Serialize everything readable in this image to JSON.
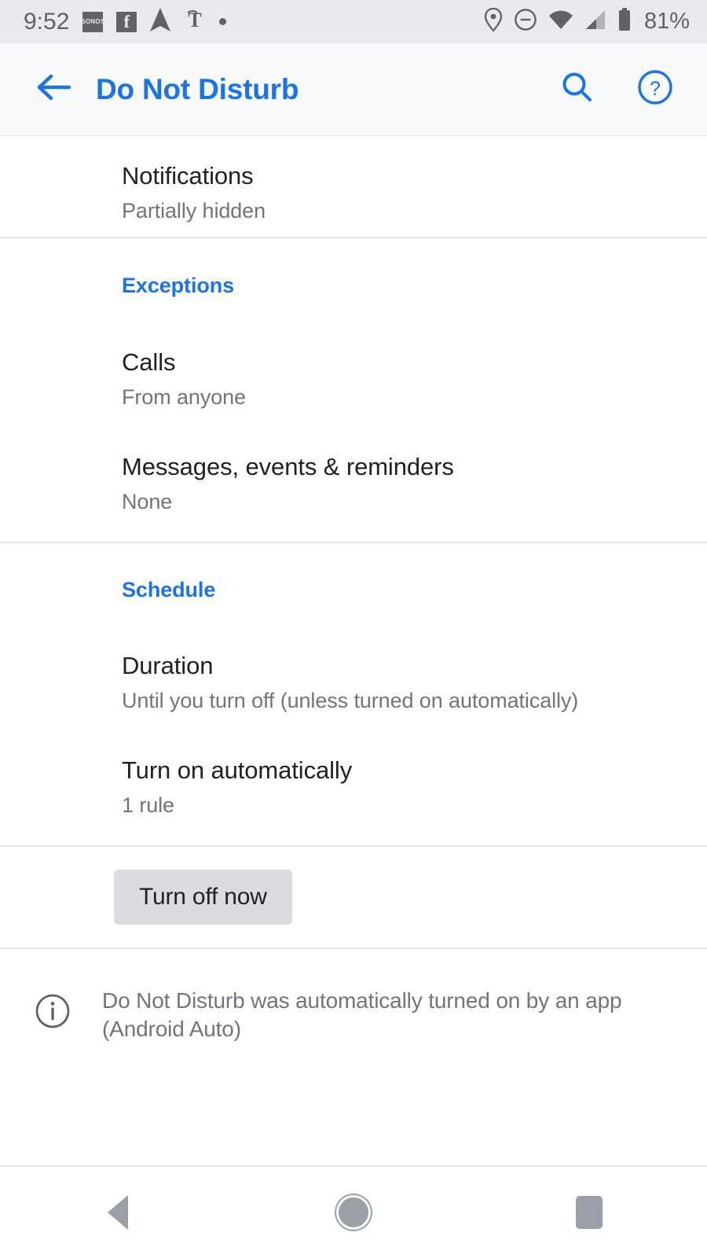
{
  "status_bar": {
    "time": "9:52",
    "battery_percent": "81%",
    "left_icons": [
      "sonos-icon",
      "facebook-icon",
      "navigation-arrow-icon",
      "nytimes-icon",
      "dot-icon"
    ],
    "sonos_label": "SONOS",
    "facebook_label": "f",
    "nytimes_label": "T",
    "right_icons": [
      "location-icon",
      "do-not-disturb-icon",
      "wifi-icon",
      "cellular-signal-icon",
      "battery-icon"
    ],
    "background_color": "#e8eaed",
    "foreground_color": "#5f6368"
  },
  "app_bar": {
    "title": "Do Not Disturb",
    "back_icon": "back-arrow-icon",
    "search_icon": "search-icon",
    "help_icon": "help-icon",
    "accent_color": "#1a73e8",
    "background_color": "#f8f9fa"
  },
  "preferences": {
    "notifications": {
      "title": "Notifications",
      "summary": "Partially hidden"
    },
    "calls": {
      "title": "Calls",
      "summary": "From anyone"
    },
    "messages": {
      "title": "Messages, events & reminders",
      "summary": "None"
    },
    "duration": {
      "title": "Duration",
      "summary": "Until you turn off (unless turned on automatically)"
    },
    "turn_on_automatically": {
      "title": "Turn on automatically",
      "summary": "1 rule"
    }
  },
  "sections": {
    "exceptions": "Exceptions",
    "schedule": "Schedule"
  },
  "action": {
    "turn_off_label": "Turn off now",
    "button_color": "#dadce0"
  },
  "footer": {
    "info_icon": "info-icon",
    "message": "Do Not Disturb was automatically turned on by an app (Android Auto)"
  },
  "nav_bar": {
    "back": "back-nav-button",
    "home": "home-nav-button",
    "recents": "recents-nav-button"
  }
}
